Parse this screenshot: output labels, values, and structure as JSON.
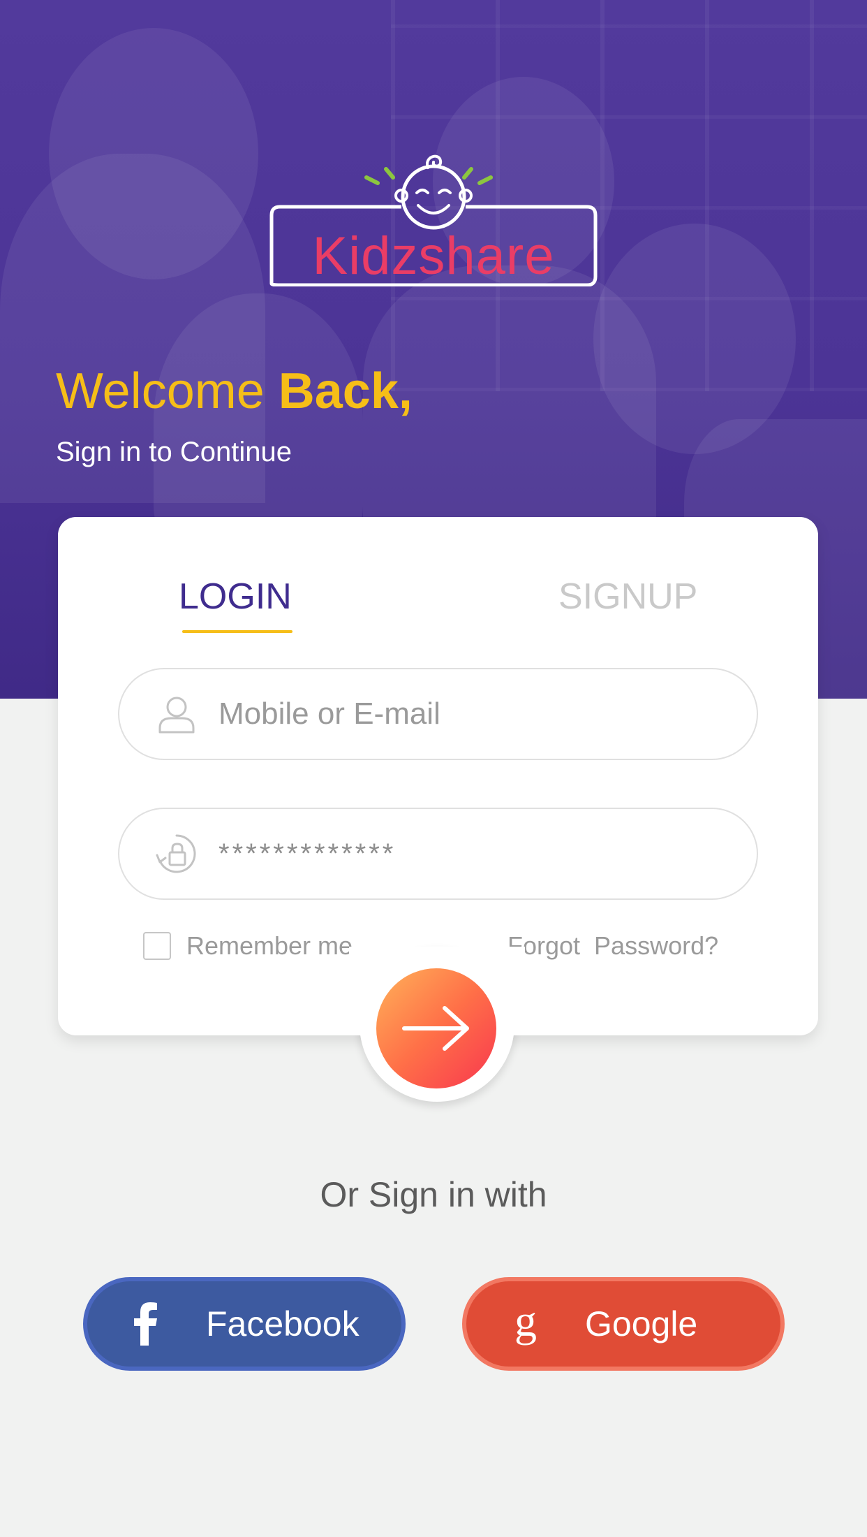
{
  "header": {
    "logo_text": "Kidzshare",
    "welcome_prefix": "Welcome ",
    "welcome_strong": "Back,",
    "subtitle": "Sign in to Continue"
  },
  "auth_card": {
    "tabs": [
      {
        "label": "LOGIN",
        "active": true
      },
      {
        "label": "SIGNUP",
        "active": false
      }
    ],
    "username": {
      "placeholder": "Mobile or E-mail",
      "value": "",
      "icon": "user-icon"
    },
    "password": {
      "value": "*************",
      "icon": "lock-refresh-icon"
    },
    "remember_label": "Remember me",
    "remember_checked": false,
    "forgot_label": "Forgot  Password?",
    "submit_icon": "arrow-right-icon"
  },
  "social": {
    "heading": "Or Sign in with",
    "facebook_label": "Facebook",
    "facebook_icon": "facebook-icon",
    "google_label": "Google",
    "google_icon": "google-icon"
  },
  "colors": {
    "hero_purple": "#4c3496",
    "accent_yellow": "#f6be18",
    "logo_pink": "#ea3d66",
    "tab_active": "#3f2c8e",
    "facebook_blue": "#3d5aa0",
    "google_red": "#e04c36",
    "submit_gradient_start": "#ffb259",
    "submit_gradient_end": "#f8374f"
  }
}
